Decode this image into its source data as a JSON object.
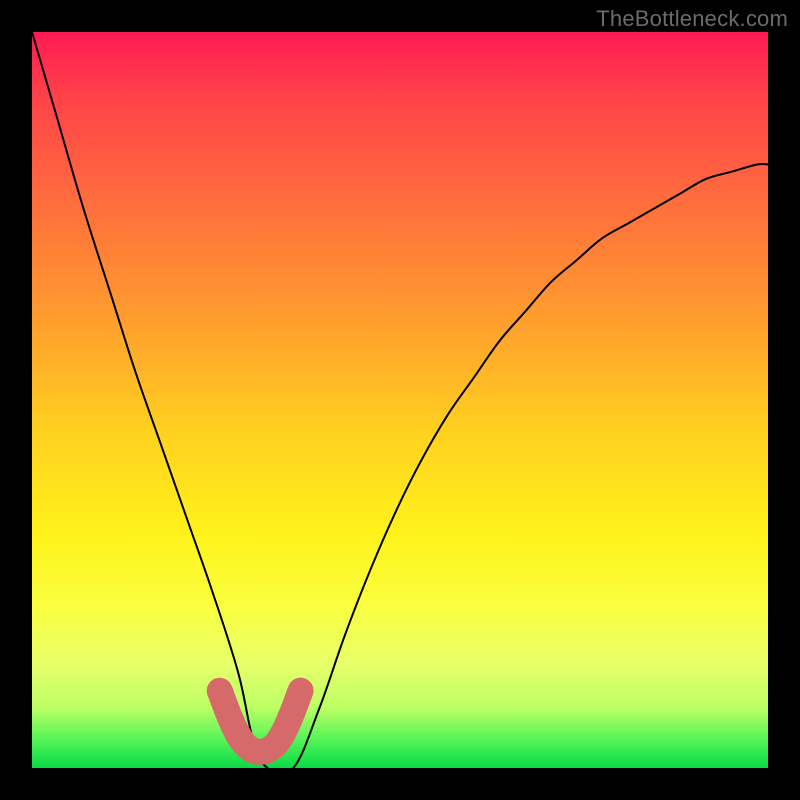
{
  "watermark": "TheBottleneck.com",
  "chart_data": {
    "type": "line",
    "title": "",
    "xlabel": "",
    "ylabel": "",
    "xlim": [
      0,
      100
    ],
    "ylim": [
      0,
      100
    ],
    "series": [
      {
        "name": "curve",
        "x": [
          0,
          3.5,
          7,
          10.5,
          14,
          17.5,
          21,
          24.5,
          28,
          30,
          32,
          35.5,
          39,
          42.5,
          46,
          49.5,
          53,
          56.5,
          60,
          63.5,
          67,
          70.5,
          74,
          77.5,
          81,
          84.5,
          88,
          91.5,
          95,
          98.5,
          100
        ],
        "y": [
          100,
          88,
          76,
          65,
          54,
          44,
          34,
          24,
          13,
          4,
          0,
          0,
          8,
          18,
          27,
          35,
          42,
          48,
          53,
          58,
          62,
          66,
          69,
          72,
          74,
          76,
          78,
          80,
          81,
          82,
          82
        ]
      }
    ],
    "marker": {
      "name": "bottleneck-highlight",
      "color": "#d66a6b",
      "points": [
        {
          "x": 25.5,
          "y": 10.5
        },
        {
          "x": 27.0,
          "y": 6.5
        },
        {
          "x": 28.5,
          "y": 3.5
        },
        {
          "x": 30.0,
          "y": 2.3
        },
        {
          "x": 31.0,
          "y": 2.2
        },
        {
          "x": 32.0,
          "y": 2.3
        },
        {
          "x": 33.5,
          "y": 3.5
        },
        {
          "x": 35.0,
          "y": 6.5
        },
        {
          "x": 36.5,
          "y": 10.5
        }
      ]
    },
    "gradient_stops": [
      {
        "offset": 0,
        "color": "#ff1a53"
      },
      {
        "offset": 8,
        "color": "#ff3f4a"
      },
      {
        "offset": 22,
        "color": "#ff6a3e"
      },
      {
        "offset": 38,
        "color": "#ff9a2e"
      },
      {
        "offset": 54,
        "color": "#ffd020"
      },
      {
        "offset": 68,
        "color": "#fff21a"
      },
      {
        "offset": 78,
        "color": "#f9ff3f"
      },
      {
        "offset": 86,
        "color": "#e8ff6a"
      },
      {
        "offset": 92,
        "color": "#b8ff64"
      },
      {
        "offset": 96,
        "color": "#57f45a"
      },
      {
        "offset": 99,
        "color": "#1ce24a"
      },
      {
        "offset": 100,
        "color": "#0cd847"
      }
    ]
  }
}
